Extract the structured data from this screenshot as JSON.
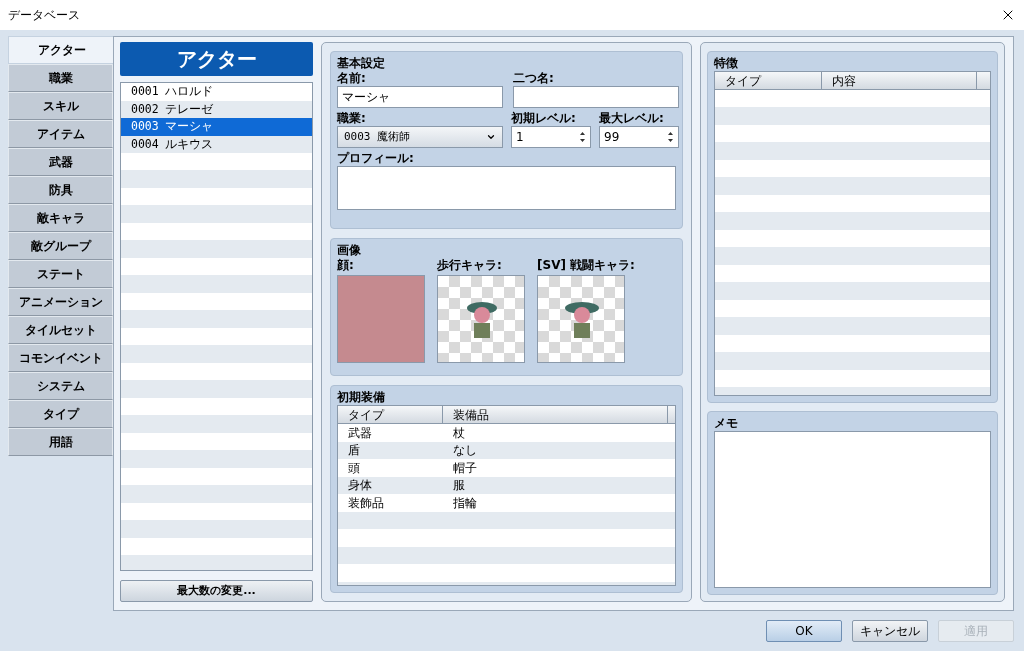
{
  "window": {
    "title": "データベース"
  },
  "tabs": [
    {
      "label": "アクター",
      "selected": true
    },
    {
      "label": "職業",
      "selected": false
    },
    {
      "label": "スキル",
      "selected": false
    },
    {
      "label": "アイテム",
      "selected": false
    },
    {
      "label": "武器",
      "selected": false
    },
    {
      "label": "防具",
      "selected": false
    },
    {
      "label": "敵キャラ",
      "selected": false
    },
    {
      "label": "敵グループ",
      "selected": false
    },
    {
      "label": "ステート",
      "selected": false
    },
    {
      "label": "アニメーション",
      "selected": false
    },
    {
      "label": "タイルセット",
      "selected": false
    },
    {
      "label": "コモンイベント",
      "selected": false
    },
    {
      "label": "システム",
      "selected": false
    },
    {
      "label": "タイプ",
      "selected": false
    },
    {
      "label": "用語",
      "selected": false
    }
  ],
  "list": {
    "header": "アクター",
    "items": [
      {
        "id": "0001",
        "name": "ハロルド",
        "selected": false
      },
      {
        "id": "0002",
        "name": "テレーゼ",
        "selected": false
      },
      {
        "id": "0003",
        "name": "マーシャ",
        "selected": true
      },
      {
        "id": "0004",
        "name": "ルキウス",
        "selected": false
      }
    ],
    "button": "最大数の変更..."
  },
  "basic": {
    "title": "基本設定",
    "name_label": "名前:",
    "name_value": "マーシャ",
    "nickname_label": "二つ名:",
    "class_label": "職業:",
    "class_value": "0003 魔術師",
    "initial_level_label": "初期レベル:",
    "initial_level_value": "1",
    "max_level_label": "最大レベル:",
    "max_level_value": "99",
    "profile_label": "プロフィール:"
  },
  "images": {
    "title": "画像",
    "face_label": "顔:",
    "walk_label": "歩行キャラ:",
    "battle_label": "[SV] 戦闘キャラ:"
  },
  "equipment": {
    "title": "初期装備",
    "columns": [
      "タイプ",
      "装備品"
    ],
    "rows": [
      [
        "武器",
        "杖"
      ],
      [
        "盾",
        "なし"
      ],
      [
        "頭",
        "帽子"
      ],
      [
        "身体",
        "服"
      ],
      [
        "装飾品",
        "指輪"
      ]
    ]
  },
  "traits": {
    "title": "特徴",
    "columns": [
      "タイプ",
      "内容"
    ]
  },
  "note": {
    "title": "メモ"
  },
  "footer": [
    {
      "label": "OK",
      "disabled": false,
      "default": true
    },
    {
      "label": "キャンセル",
      "disabled": false,
      "default": false
    },
    {
      "label": "適用",
      "disabled": true,
      "default": false
    }
  ]
}
